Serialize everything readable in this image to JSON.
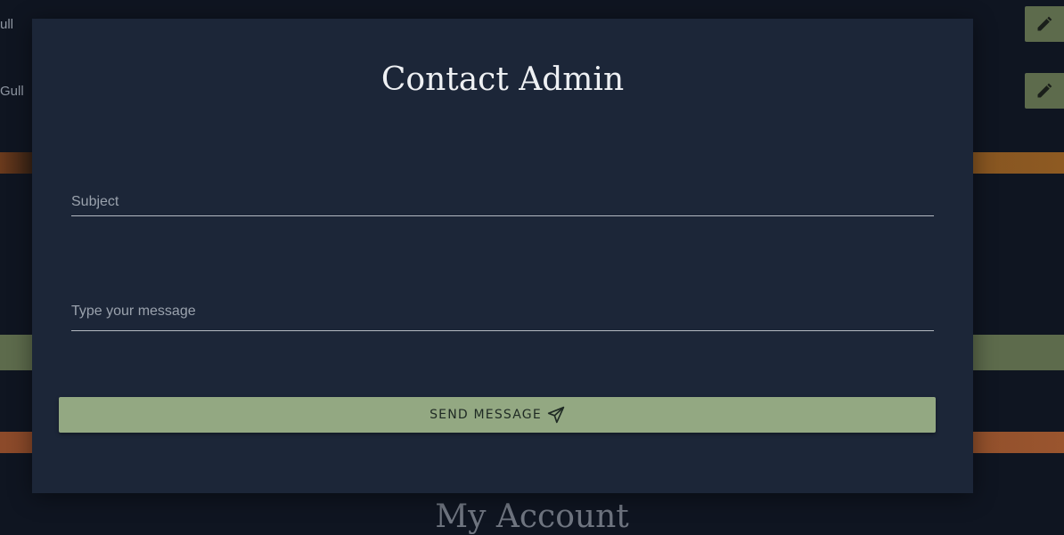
{
  "background": {
    "list_items": [
      "ull",
      "Gull"
    ],
    "heading": "My Account",
    "edit_icon": "pencil-icon",
    "accent_color": "#5d6b4c"
  },
  "modal": {
    "title": "Contact Admin",
    "subject_field": {
      "placeholder": "Subject",
      "value": ""
    },
    "message_field": {
      "placeholder": "Type your message",
      "value": ""
    },
    "send_button": {
      "label": "SEND MESSAGE",
      "icon": "paper-plane-icon",
      "color": "#93a882"
    },
    "background_color": "#1c2638"
  }
}
